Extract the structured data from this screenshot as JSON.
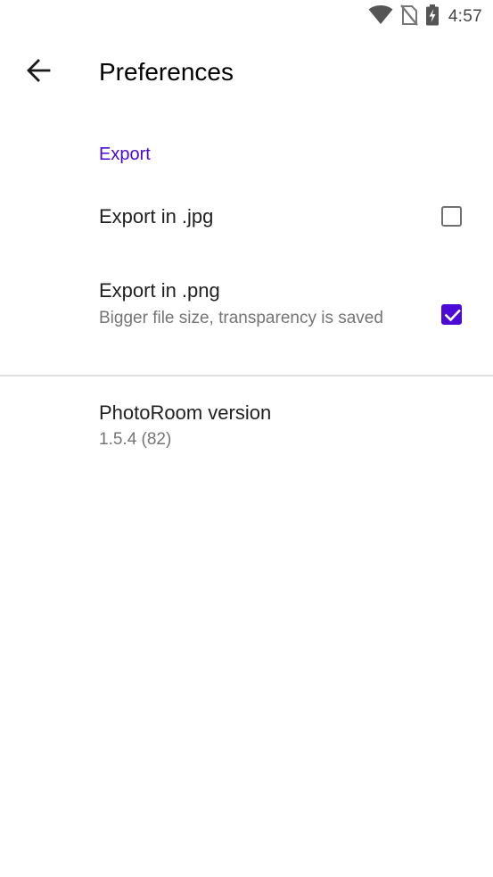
{
  "status_bar": {
    "time": "4:57",
    "icons": [
      "wifi-icon",
      "no-sim-icon",
      "battery-charging-icon"
    ]
  },
  "app_bar": {
    "back_icon": "arrow-left-icon",
    "title": "Preferences"
  },
  "colors": {
    "accent": "#4b0ad6",
    "title_text": "#1f1f1f",
    "summary_text": "#757575",
    "divider": "#dddddd"
  },
  "preferences": {
    "export_category": "Export",
    "items": [
      {
        "title": "Export in .jpg",
        "summary": "",
        "checked": false
      },
      {
        "title": "Export in .png",
        "summary": "Bigger file size, transparency is saved",
        "checked": true
      }
    ],
    "version": {
      "title": "PhotoRoom version",
      "summary": "1.5.4 (82)"
    }
  }
}
